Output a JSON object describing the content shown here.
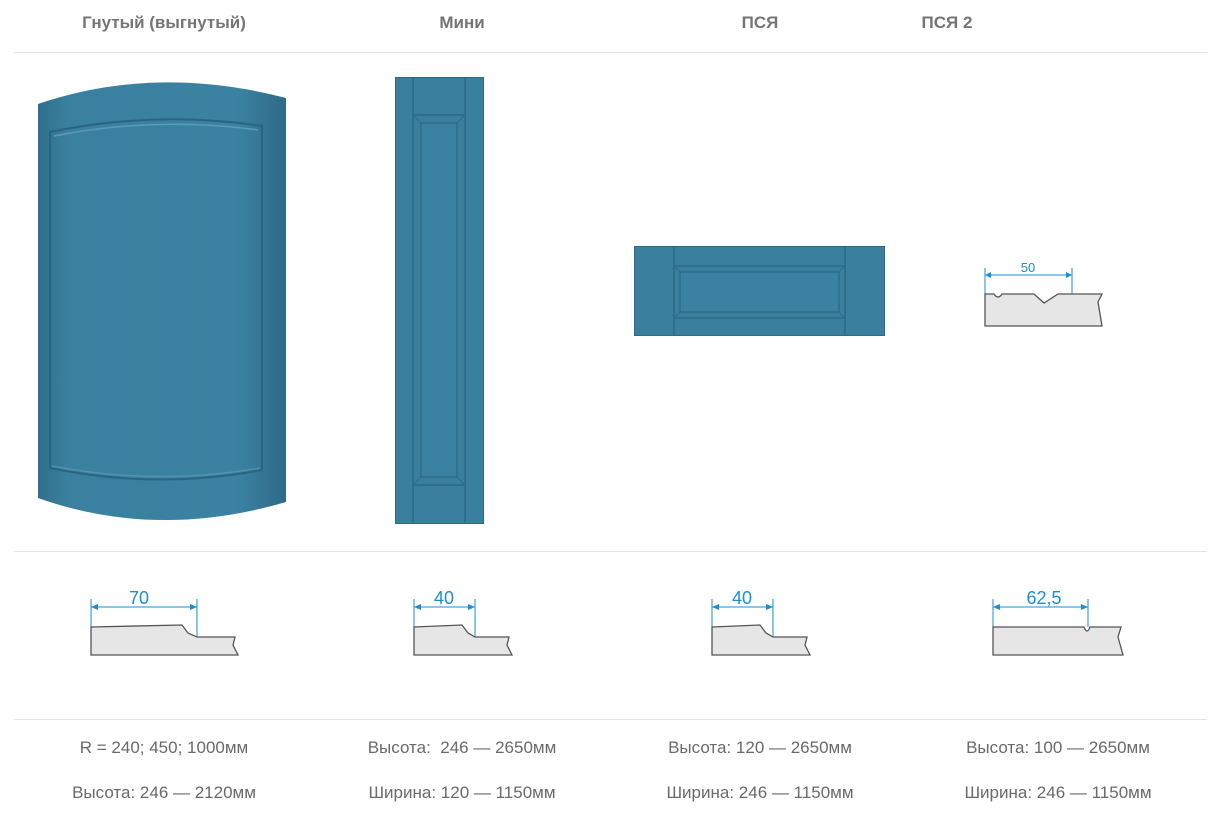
{
  "columns": [
    {
      "title": "Гнутый (выгнутый)",
      "dimension": "70",
      "specs": [
        "R = 240; 450; 1000мм",
        "Высота: 246 — 2120мм"
      ]
    },
    {
      "title": "Мини",
      "dimension": "40",
      "specs": [
        "Высота:  246 — 2650мм",
        "Ширина: 120 — 1150мм"
      ]
    },
    {
      "title": "ПСЯ",
      "dimension": "40",
      "specs": [
        "Высота: 120 — 2650мм",
        "Ширина: 246 — 1150мм"
      ]
    },
    {
      "title": "ПСЯ 2",
      "dimension": "62,5",
      "top_profile_dimension": "50",
      "specs": [
        "Высота: 100 — 2650мм",
        "Ширина: 246 — 1150мм"
      ]
    }
  ],
  "colors": {
    "facade": "#3a7f9e",
    "facade_dark": "#2d6a86",
    "profile_fill": "#e6e6e6",
    "profile_stroke": "#555555",
    "dimension": "#1a8fd6"
  }
}
